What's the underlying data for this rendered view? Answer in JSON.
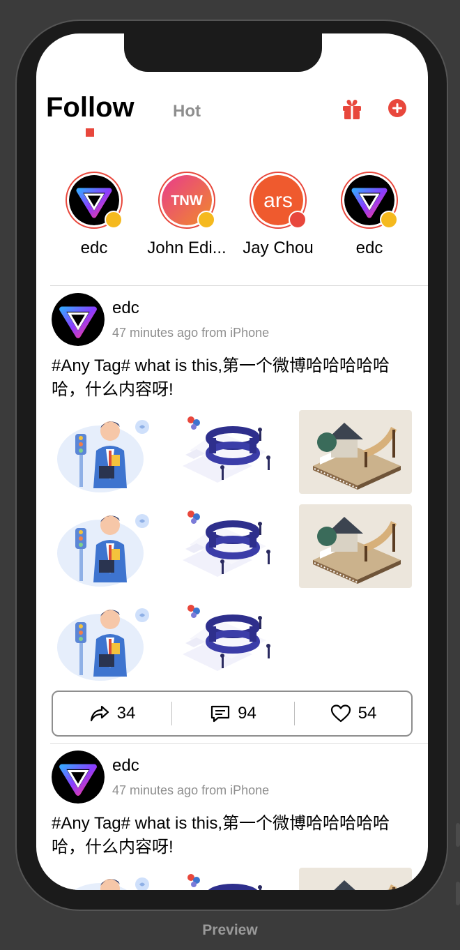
{
  "header": {
    "tab_follow": "Follow",
    "tab_hot": "Hot",
    "icons": [
      "gift-icon",
      "add-circle-icon"
    ],
    "accent_color": "#e8473c"
  },
  "stories": [
    {
      "name": "edc",
      "avatar": "edc-logo",
      "badge": "gold"
    },
    {
      "name": "John Edi...",
      "avatar": "tnw-logo",
      "badge": "gold"
    },
    {
      "name": "Jay Chou",
      "avatar": "ars-logo",
      "badge": "hot"
    },
    {
      "name": "edc",
      "avatar": "edc-logo",
      "badge": "gold"
    }
  ],
  "posts": [
    {
      "author": "edc",
      "meta": "47 minutes ago from iPhone",
      "text": "#Any Tag# what is this,第一个微博哈哈哈哈哈哈，什么内容呀!",
      "images": [
        "business-man",
        "isometric-circle",
        "isometric-house",
        "business-man",
        "isometric-circle",
        "isometric-house",
        "business-man",
        "isometric-circle"
      ],
      "reposts": "34",
      "comments": "94",
      "likes": "54"
    },
    {
      "author": "edc",
      "meta": "47 minutes ago from iPhone",
      "text": "#Any Tag# what is this,第一个微博哈哈哈哈哈哈，什么内容呀!"
    }
  ],
  "footer": {
    "label": "Preview"
  }
}
